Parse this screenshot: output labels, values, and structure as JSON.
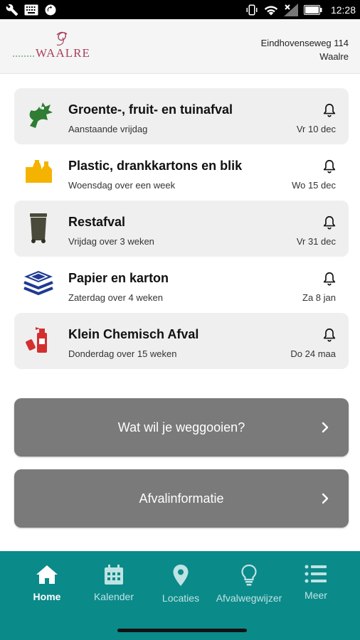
{
  "status_bar": {
    "time": "12:28",
    "left_icons": [
      "wrench-icon",
      "keyboard-icon",
      "sync-icon"
    ],
    "right_icons": [
      "vibrate-icon",
      "wifi-icon",
      "signal-icon",
      "battery-icon"
    ]
  },
  "header": {
    "logo_text": "WAALRE",
    "address_line1": "Eindhovenseweg 114",
    "address_line2": "Waalre"
  },
  "collections": [
    {
      "icon": "gft-leaf-icon",
      "title": "Groente-, fruit- en tuinafval",
      "subtitle": "Aanstaande vrijdag",
      "date": "Vr 10 dec",
      "color": "#2e7d32"
    },
    {
      "icon": "plastic-bottles-icon",
      "title": "Plastic, drankkartons en blik",
      "subtitle": "Woensdag over een week",
      "date": "Wo 15 dec",
      "color": "#f5b301"
    },
    {
      "icon": "wheelie-bin-icon",
      "title": "Restafval",
      "subtitle": "Vrijdag over 3 weken",
      "date": "Vr 31 dec",
      "color": "#4a4a3a"
    },
    {
      "icon": "paper-stack-icon",
      "title": "Papier en karton",
      "subtitle": "Zaterdag over 4 weken",
      "date": "Za 8 jan",
      "color": "#1f3a93"
    },
    {
      "icon": "chemical-spray-icon",
      "title": "Klein Chemisch Afval",
      "subtitle": "Donderdag over 15 weken",
      "date": "Do 24 maa",
      "color": "#d32f2f"
    }
  ],
  "buttons": {
    "what_to_throw": "Wat wil je weggooien?",
    "waste_info": "Afvalinformatie"
  },
  "nav": {
    "items": [
      {
        "label": "Home",
        "icon": "home-icon",
        "active": true
      },
      {
        "label": "Kalender",
        "icon": "calendar-icon",
        "active": false
      },
      {
        "label": "Locaties",
        "icon": "location-pin-icon",
        "active": false
      },
      {
        "label": "Afvalwegwijzer",
        "icon": "lightbulb-icon",
        "active": false
      },
      {
        "label": "Meer",
        "icon": "menu-list-icon",
        "active": false
      }
    ]
  },
  "colors": {
    "nav_background": "#0b8a8a",
    "button_background": "#7a7a7a",
    "row_shade": "#efefef",
    "logo": "#a8425b"
  }
}
